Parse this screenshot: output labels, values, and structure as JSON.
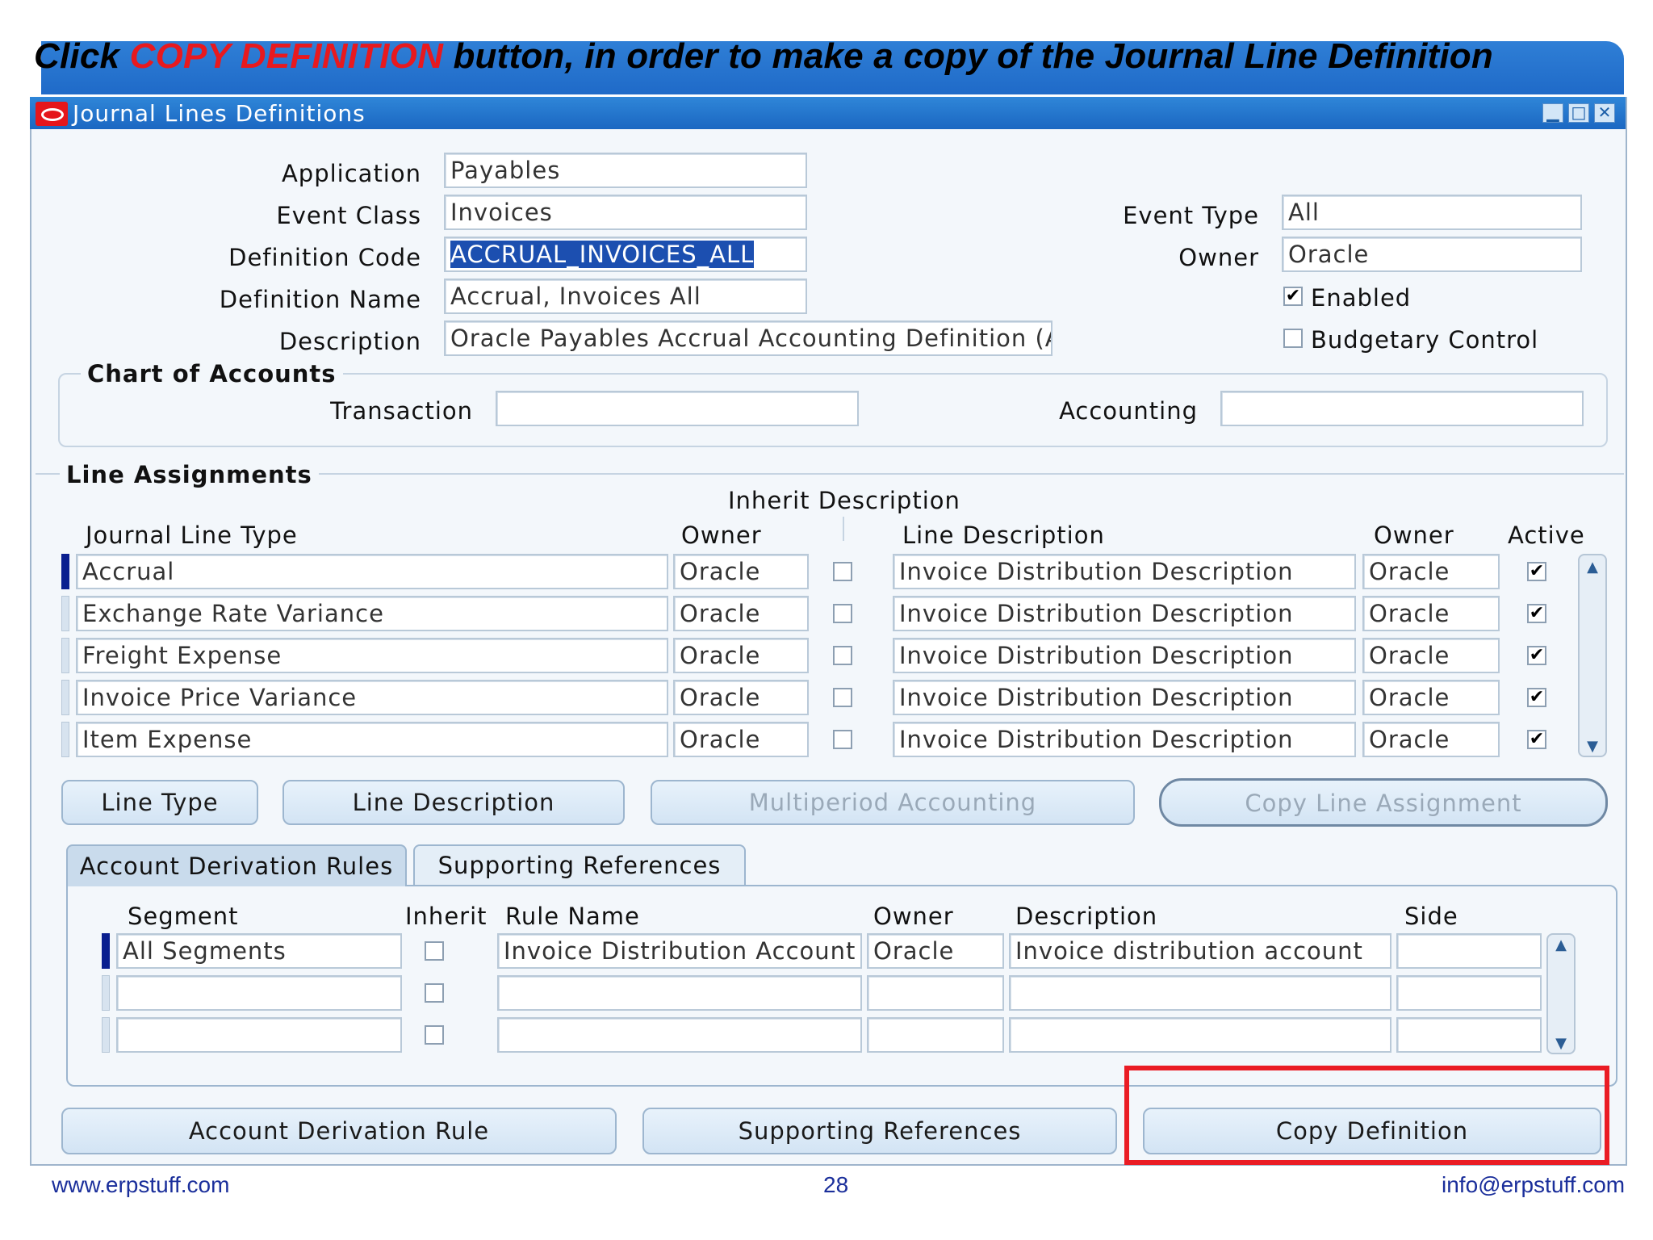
{
  "instruction": {
    "prefix": "Click ",
    "highlight": "COPY DEFINITION",
    "suffix": " button, in order to make a copy of the Journal Line Definition"
  },
  "window": {
    "title": "Journal Lines Definitions",
    "minimize_glyph": "▁",
    "maximize_glyph": "□",
    "close_glyph": "✕"
  },
  "header_form": {
    "application_label": "Application",
    "application_value": "Payables",
    "event_class_label": "Event Class",
    "event_class_value": "Invoices",
    "definition_code_label": "Definition Code",
    "definition_code_value": "ACCRUAL_INVOICES_ALL",
    "definition_name_label": "Definition Name",
    "definition_name_value": "Accrual, Invoices All",
    "description_label": "Description",
    "description_value": "Oracle Payables Accrual Accounting Definition (A",
    "event_type_label": "Event Type",
    "event_type_value": "All",
    "owner_label": "Owner",
    "owner_value": "Oracle",
    "enabled_label": "Enabled",
    "enabled_checked": true,
    "budgetary_label": "Budgetary Control",
    "budgetary_checked": false
  },
  "chart_of_accounts": {
    "title": "Chart of Accounts",
    "transaction_label": "Transaction",
    "transaction_value": "",
    "accounting_label": "Accounting",
    "accounting_value": ""
  },
  "line_assignments": {
    "title": "Line Assignments",
    "inherit_description_header": "Inherit Description",
    "col_journal_line_type": "Journal Line Type",
    "col_owner": "Owner",
    "col_line_description": "Line Description",
    "col_owner2": "Owner",
    "col_active": "Active",
    "rows": [
      {
        "type": "Accrual",
        "owner": "Oracle",
        "inherit": false,
        "line_description": "Invoice Distribution Description",
        "desc_owner": "Oracle",
        "active": true
      },
      {
        "type": "Exchange Rate Variance",
        "owner": "Oracle",
        "inherit": false,
        "line_description": "Invoice Distribution Description",
        "desc_owner": "Oracle",
        "active": true
      },
      {
        "type": "Freight Expense",
        "owner": "Oracle",
        "inherit": false,
        "line_description": "Invoice Distribution Description",
        "desc_owner": "Oracle",
        "active": true
      },
      {
        "type": "Invoice Price Variance",
        "owner": "Oracle",
        "inherit": false,
        "line_description": "Invoice Distribution Description",
        "desc_owner": "Oracle",
        "active": true
      },
      {
        "type": "Item Expense",
        "owner": "Oracle",
        "inherit": false,
        "line_description": "Invoice Distribution Description",
        "desc_owner": "Oracle",
        "active": true
      }
    ],
    "buttons": {
      "line_type": "Line Type",
      "line_description": "Line Description",
      "multiperiod": "Multiperiod Accounting",
      "copy_line_assignment": "Copy Line Assignment"
    }
  },
  "tabs": {
    "account_derivation_rules": "Account Derivation Rules",
    "supporting_references": "Supporting References"
  },
  "derivation": {
    "col_segment": "Segment",
    "col_inherit": "Inherit",
    "col_rule_name": "Rule Name",
    "col_owner": "Owner",
    "col_description": "Description",
    "col_side": "Side",
    "rows": [
      {
        "segment": "All Segments",
        "inherit": false,
        "rule_name": "Invoice Distribution Account",
        "owner": "Oracle",
        "description": "Invoice distribution account",
        "side": ""
      },
      {
        "segment": "",
        "inherit": false,
        "rule_name": "",
        "owner": "",
        "description": "",
        "side": ""
      },
      {
        "segment": "",
        "inherit": false,
        "rule_name": "",
        "owner": "",
        "description": "",
        "side": ""
      }
    ]
  },
  "bottom_buttons": {
    "account_derivation_rule": "Account Derivation Rule",
    "supporting_references": "Supporting References",
    "copy_definition": "Copy Definition"
  },
  "footer": {
    "website": "www.erpstuff.com",
    "page_number": "28",
    "email": "info@erpstuff.com"
  },
  "colors": {
    "title_bar": "#1f6ac8",
    "highlight_text": "#e8191e",
    "highlight_box": "#ea1c24"
  }
}
